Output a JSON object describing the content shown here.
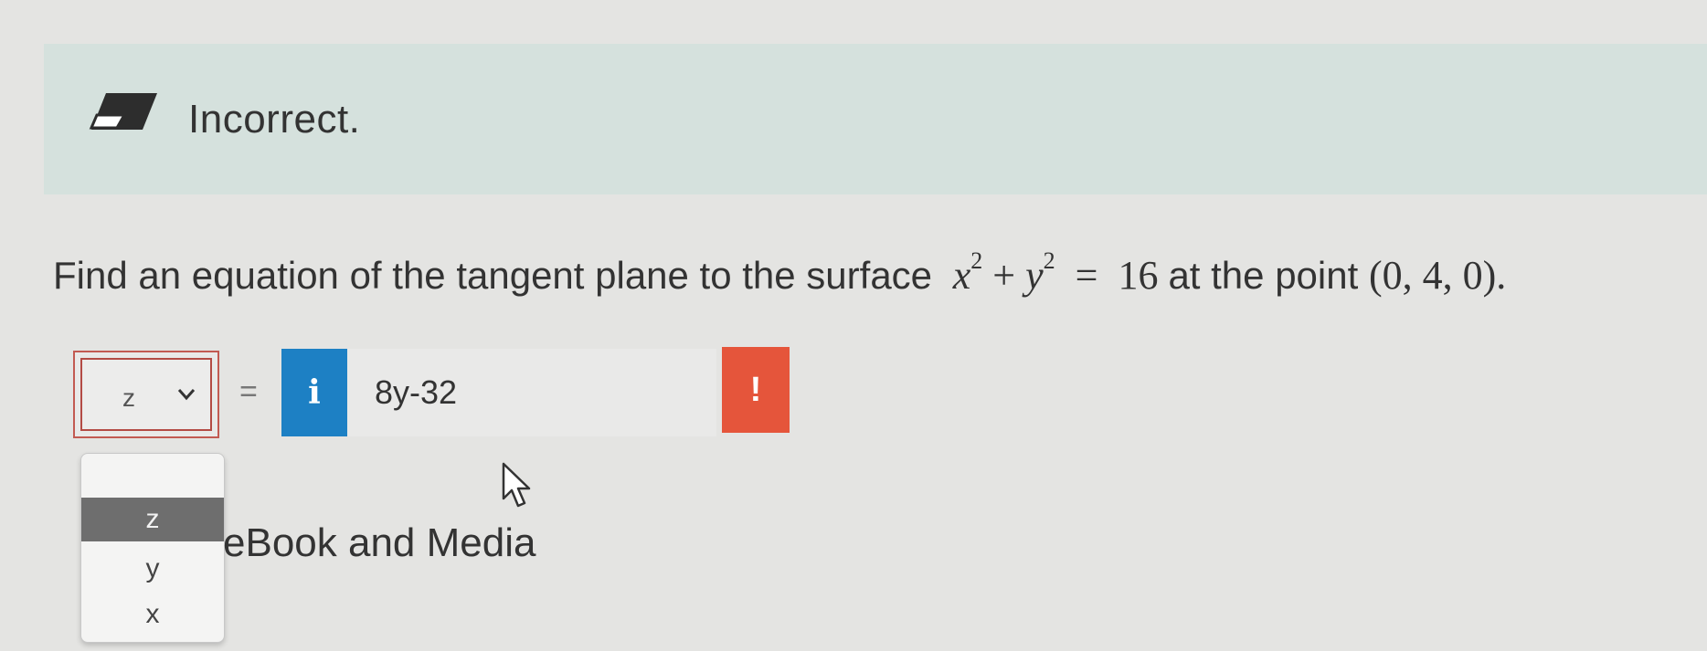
{
  "feedback": {
    "status_text": "Incorrect.",
    "icon": "eraser-icon"
  },
  "question": {
    "prompt_prefix": "Find an equation of the tangent plane to the surface",
    "at_the_point": "at the point",
    "equation": {
      "x": "x",
      "exp": "2",
      "plus": "+",
      "y": "y",
      "eq": "=",
      "rhs": "16"
    },
    "point": "(0, 4, 0)",
    "end": "."
  },
  "answer": {
    "variable_selected": "z",
    "equals": "=",
    "info_label": "i",
    "expression_value": "8y-32",
    "error_label": "!"
  },
  "dropdown": {
    "options": [
      "",
      "z",
      "y",
      "x"
    ],
    "selected_index": 1
  },
  "resources": {
    "ebook_label": "eBook and Media"
  },
  "colors": {
    "banner_bg": "#d5e1dd",
    "select_border": "#c25a52",
    "info_blue": "#1d80c4",
    "error_orange": "#e5553b"
  }
}
